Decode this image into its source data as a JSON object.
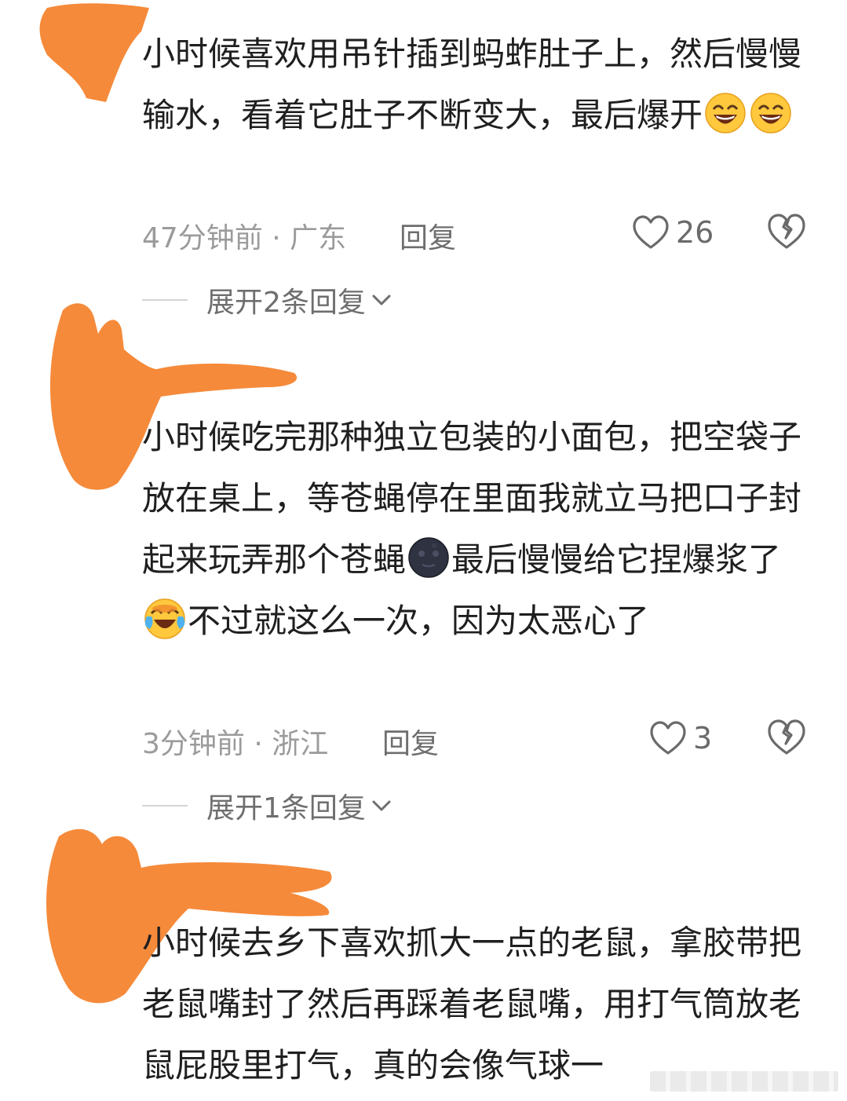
{
  "comments": [
    {
      "text_parts": [
        "小时候喜欢用吊针插到蚂蚱肚子上，然后慢慢输水，看着它肚子不断变大，最后爆开"
      ],
      "emojis": [
        "grinning-face-icon",
        "grinning-face-icon"
      ],
      "time_location": "47分钟前 · 广东",
      "reply_label": "回复",
      "likes": "26",
      "expand_label": "展开2条回复"
    },
    {
      "text_parts": [
        "小时候吃完那种独立包装的小面包，把空袋子放在桌上，等苍蝇停在里面我就立马把口子封起来玩弄那个苍蝇",
        "最后慢慢给它捏爆浆了",
        "不过就这么一次，因为太恶心了"
      ],
      "emojis": [
        "new-moon-face-icon",
        "crying-laughing-face-icon"
      ],
      "time_location": "3分钟前 · 浙江",
      "reply_label": "回复",
      "likes": "3",
      "expand_label": "展开1条回复"
    },
    {
      "text_parts": [
        "小时候去乡下喜欢抓大一点的老鼠，拿胶带把老鼠嘴封了然后再踩着老鼠嘴，用打气筒放老鼠屁股里打气，真的会像气球一"
      ]
    }
  ],
  "colors": {
    "redaction": "#F58A3A",
    "text": "#1f1f1f",
    "meta": "#9b9b9b"
  }
}
